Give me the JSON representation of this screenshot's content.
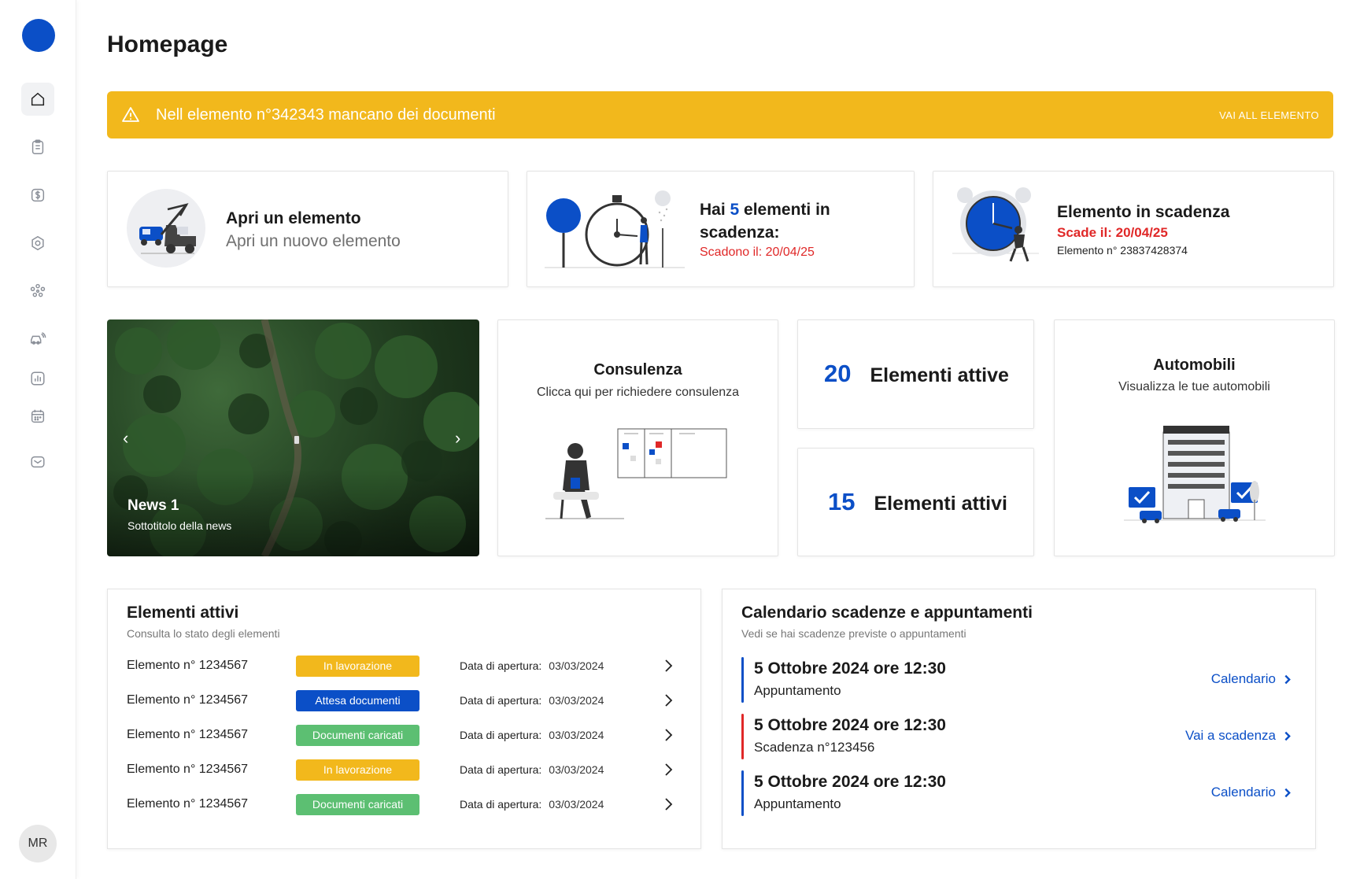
{
  "sidebar": {
    "items": [
      {
        "icon": "home-icon"
      },
      {
        "icon": "clipboard-icon"
      },
      {
        "icon": "dollar-icon"
      },
      {
        "icon": "hexagon-icon"
      },
      {
        "icon": "people-network-icon"
      },
      {
        "icon": "car-icon"
      },
      {
        "icon": "chart-icon"
      },
      {
        "icon": "calendar-icon"
      },
      {
        "icon": "mail-icon"
      }
    ],
    "avatar_initials": "MR"
  },
  "page_title": "Homepage",
  "alert": {
    "text": "Nell elemento n°342343 mancano dei documenti",
    "action": "VAI ALL ELEMENTO"
  },
  "cards": {
    "open": {
      "title": "Apri un elemento",
      "subtitle": "Apri un nuovo elemento"
    },
    "expiring_count": {
      "pre": "Hai ",
      "num": "5",
      "post": " elementi in scadenza:",
      "date": "Scadono il: 20/04/25"
    },
    "expiring": {
      "title": "Elemento in scadenza",
      "date": "Scade il: 20/04/25",
      "code": "Elemento n° 23837428374"
    }
  },
  "news": {
    "title": "News 1",
    "subtitle": "Sottotitolo della news",
    "prev": "‹",
    "next": "›"
  },
  "consulenza": {
    "title": "Consulenza",
    "subtitle": "Clicca qui per richiedere consulenza"
  },
  "stats": [
    {
      "num": "20",
      "label": "Elementi attive"
    },
    {
      "num": "15",
      "label": "Elementi attivi"
    }
  ],
  "automobili": {
    "title": "Automobili",
    "subtitle": "Visualizza le tue automobili"
  },
  "active_panel": {
    "title": "Elementi attivi",
    "subtitle": "Consulta lo stato degli elementi",
    "date_label": "Data di apertura:",
    "rows": [
      {
        "name": "Elemento n° 1234567",
        "status": "In lavorazione",
        "color": "#f2b81c",
        "date": "03/03/2024"
      },
      {
        "name": "Elemento n° 1234567",
        "status": "Attesa documenti",
        "color": "#0b4fc7",
        "date": "03/03/2024"
      },
      {
        "name": "Elemento n° 1234567",
        "status": "Documenti caricati",
        "color": "#5cbf72",
        "date": "03/03/2024"
      },
      {
        "name": "Elemento n° 1234567",
        "status": "In lavorazione",
        "color": "#f2b81c",
        "date": "03/03/2024"
      },
      {
        "name": "Elemento n° 1234567",
        "status": "Documenti caricati",
        "color": "#5cbf72",
        "date": "03/03/2024"
      }
    ]
  },
  "calendar_panel": {
    "title": "Calendario scadenze e appuntamenti",
    "subtitle": "Vedi se hai scadenze previste o appuntamenti",
    "events": [
      {
        "date": "5 Ottobre 2024 ore 12:30",
        "kind": "Appuntamento",
        "action": "Calendario",
        "color": "#0b4fc7"
      },
      {
        "date": "5 Ottobre 2024 ore 12:30",
        "kind": "Scadenza  n°123456",
        "action": "Vai a scadenza",
        "color": "#e02828"
      },
      {
        "date": "5 Ottobre 2024 ore 12:30",
        "kind": "Appuntamento",
        "action": "Calendario",
        "color": "#0b4fc7"
      }
    ]
  },
  "colors": {
    "accent": "#0b4fc7",
    "warning": "#f2b81c",
    "danger": "#e02828",
    "success": "#5cbf72"
  }
}
